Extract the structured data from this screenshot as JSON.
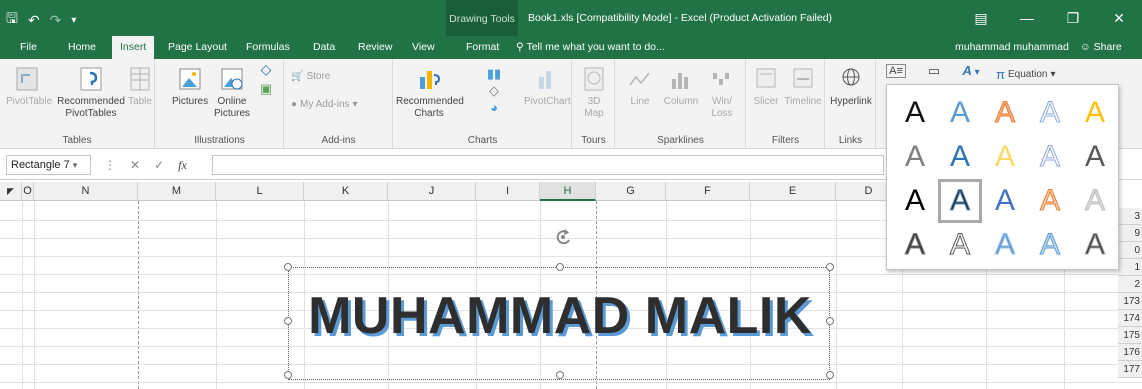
{
  "title_bar": {
    "context_tab": "Drawing Tools",
    "document_title": "Book1.xls  [Compatibility Mode] - Excel (Product Activation Failed)"
  },
  "tabs": [
    "File",
    "Home",
    "Insert",
    "Page Layout",
    "Formulas",
    "Data",
    "Review",
    "View",
    "Format"
  ],
  "active_tab": "Insert",
  "tell_me": "Tell me what you want to do...",
  "user_name": "muhammad muhammad",
  "share_label": "Share",
  "ribbon": {
    "tables": {
      "label": "Tables",
      "pivot": "PivotTable",
      "recommended_line1": "Recommended",
      "recommended_line2": "PivotTables",
      "table": "Table"
    },
    "illustrations": {
      "label": "Illustrations",
      "pictures": "Pictures",
      "online_line1": "Online",
      "online_line2": "Pictures"
    },
    "addins": {
      "label": "Add-ins",
      "store": "Store",
      "my_addins": "My Add-ins"
    },
    "charts": {
      "label": "Charts",
      "recommended_line1": "Recommended",
      "recommended_line2": "Charts",
      "pivotchart": "PivotChart"
    },
    "tours": {
      "label": "Tours",
      "map_line1": "3D",
      "map_line2": "Map"
    },
    "sparklines": {
      "label": "Sparklines",
      "line": "Line",
      "column": "Column",
      "winloss_line1": "Win/",
      "winloss_line2": "Loss"
    },
    "filters": {
      "label": "Filters",
      "slicer": "Slicer",
      "timeline": "Timeline"
    },
    "links": {
      "label": "Links",
      "hyperlink": "Hyperlink"
    },
    "symbols": {
      "equation": "Equation"
    }
  },
  "formula_bar": {
    "name_box": "Rectangle 7",
    "fx": "fx"
  },
  "columns": [
    "O",
    "N",
    "M",
    "L",
    "K",
    "J",
    "I",
    "H",
    "G",
    "F",
    "E",
    "D"
  ],
  "selected_column": "H",
  "row_numbers": [
    "3",
    "9",
    "0",
    "1",
    "2",
    "173",
    "174",
    "175",
    "176",
    "177"
  ],
  "shape_text": "MUHAMMAD MALIK",
  "wordart": {
    "rows": [
      [
        {
          "glyph": "A",
          "fill": "#111111",
          "stroke": ""
        },
        {
          "glyph": "A",
          "fill": "#5b9bd5",
          "stroke": ""
        },
        {
          "glyph": "A",
          "fill": "#f4b183",
          "stroke": "#ed7d31"
        },
        {
          "glyph": "A",
          "fill": "#ffffff",
          "stroke": "#8faadc"
        },
        {
          "glyph": "A",
          "fill": "#ffc000",
          "stroke": ""
        }
      ],
      [
        {
          "glyph": "A",
          "fill": "#7f7f7f",
          "stroke": ""
        },
        {
          "glyph": "A",
          "fill": "#2e75b6",
          "stroke": ""
        },
        {
          "glyph": "A",
          "fill": "#ffd966",
          "stroke": ""
        },
        {
          "glyph": "A",
          "fill": "#ffffff",
          "stroke": "#8faadc"
        },
        {
          "glyph": "A",
          "fill": "#595959",
          "stroke": ""
        }
      ],
      [
        {
          "glyph": "A",
          "fill": "#000000",
          "stroke": ""
        },
        {
          "glyph": "A",
          "fill": "#2e2e2e",
          "stroke": "#5b9bd5"
        },
        {
          "glyph": "A",
          "fill": "#4472c4",
          "stroke": ""
        },
        {
          "glyph": "A",
          "fill": "#f8cbad",
          "stroke": "#ed7d31"
        },
        {
          "glyph": "A",
          "fill": "#d9d9d9",
          "stroke": "#bfbfbf"
        }
      ],
      [
        {
          "glyph": "A",
          "fill": "#3a3a3a",
          "stroke": "#7f7f7f"
        },
        {
          "glyph": "A",
          "fill": "#ffffff",
          "stroke": "#595959"
        },
        {
          "glyph": "A",
          "fill": "#5b9bd5",
          "stroke": "#9dc3e6"
        },
        {
          "glyph": "A",
          "fill": "#bdd7ee",
          "stroke": "#5b9bd5"
        },
        {
          "glyph": "A",
          "fill": "#404040",
          "stroke": "#a6a6a6"
        }
      ]
    ],
    "selected": [
      2,
      1
    ]
  },
  "colors": {
    "excel_green": "#217346",
    "ribbon_bg": "#f3f3f3",
    "shape_shadow": "#5b9bd5"
  }
}
